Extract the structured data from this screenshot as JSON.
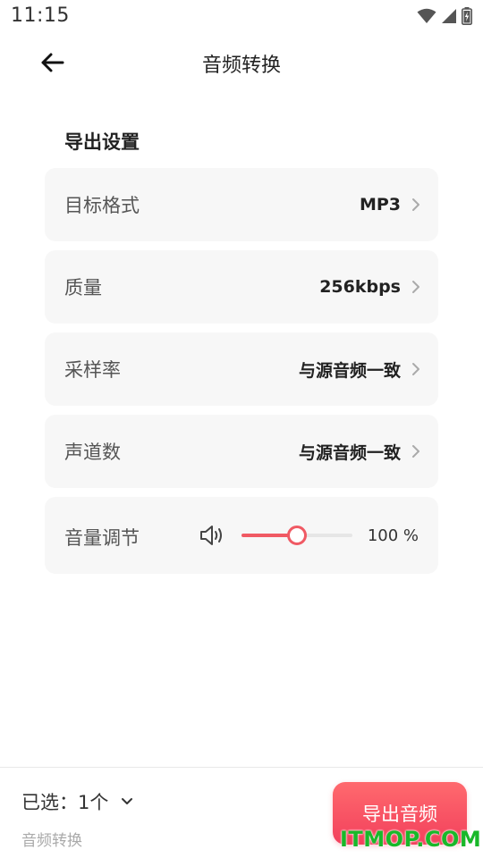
{
  "status_bar": {
    "time": "11:15",
    "icons": [
      "wifi-icon",
      "cell-signal-icon",
      "battery-charging-icon"
    ]
  },
  "app_bar": {
    "back_icon": "arrow-left-icon",
    "title": "音频转换"
  },
  "export_settings": {
    "section_title": "导出设置",
    "rows": [
      {
        "label": "目标格式",
        "value": "MP3"
      },
      {
        "label": "质量",
        "value": "256kbps"
      },
      {
        "label": "采样率",
        "value": "与源音频一致"
      },
      {
        "label": "声道数",
        "value": "与源音频一致"
      }
    ],
    "volume": {
      "label": "音量调节",
      "value_text": "100 %",
      "slider_fraction": 0.5
    }
  },
  "bottom_bar": {
    "selected_label": "已选：1个",
    "subtitle": "音频转换",
    "export_button": "导出音频"
  },
  "watermark": "ITMOP.COM",
  "colors": {
    "accent": "#f05a64",
    "card_bg": "#f7f7f7",
    "watermark": "#19b82a"
  }
}
